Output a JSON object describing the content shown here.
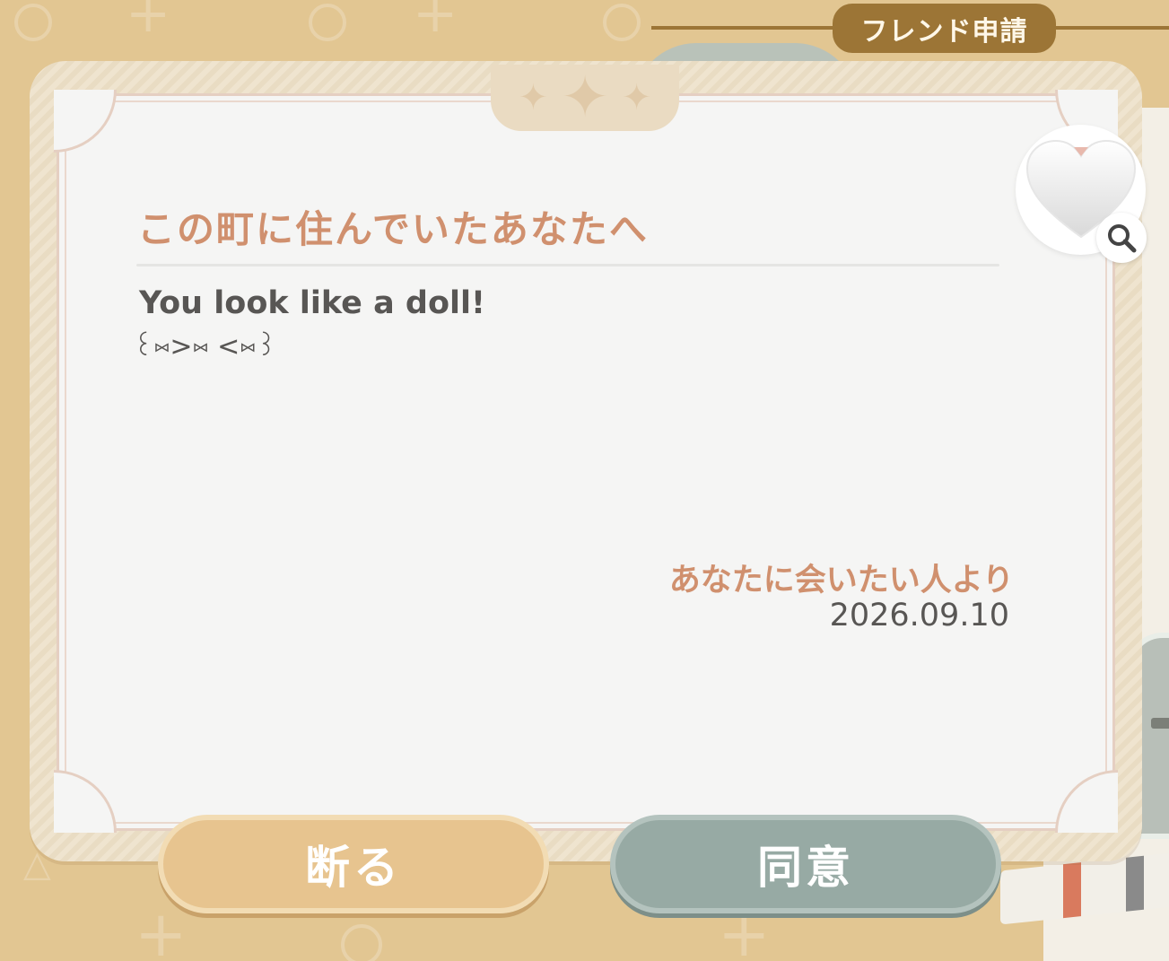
{
  "header": {
    "tab_label": "フレンド申請"
  },
  "letter": {
    "title": "この町に住んでいたあなたへ",
    "message_line1": "You look like a doll!",
    "message_line2": "꒰⑅>⑅ <⑅꒱",
    "signature": "あなたに会いたい人より",
    "date": "2026.09.10"
  },
  "icons": {
    "sparkles": [
      "sparkle-icon",
      "sparkle-icon",
      "sparkle-icon"
    ],
    "heart": "heart-icon",
    "search": "search-icon"
  },
  "buttons": {
    "decline_label": "断る",
    "agree_label": "同意"
  },
  "colors": {
    "background": "#e2c692",
    "header_tab": "#9c7536",
    "title_text": "#d0906e",
    "decline_button": "#e7c48f",
    "agree_button": "#97aaa4"
  }
}
